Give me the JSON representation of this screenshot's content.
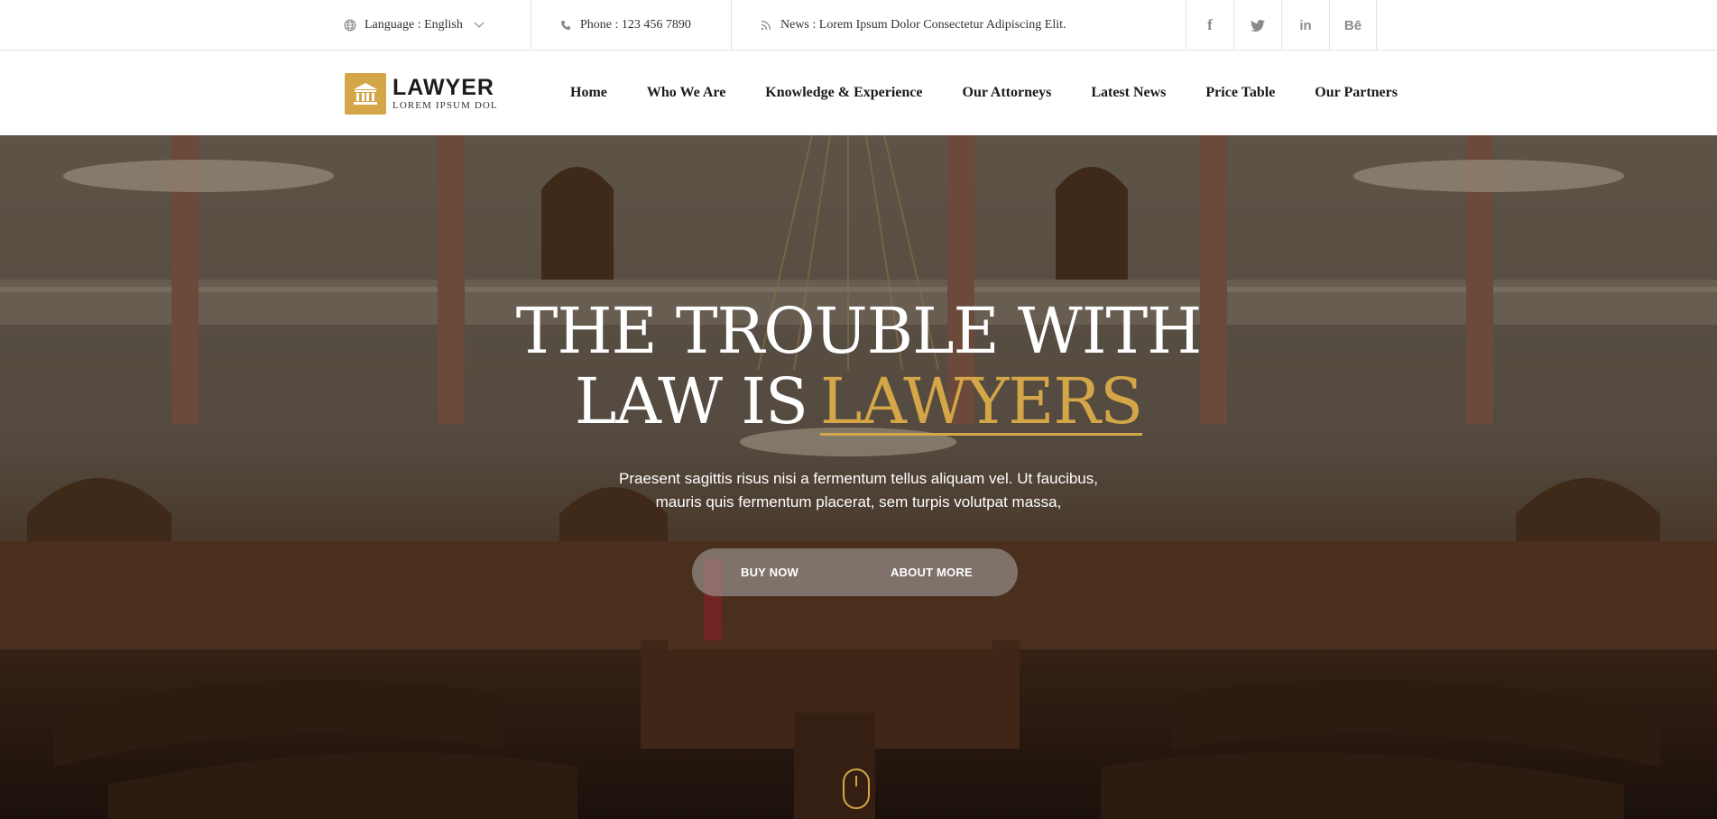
{
  "topbar": {
    "language_label": "Language : English",
    "phone_label": "Phone : 123 456 7890",
    "news_label": "News : Lorem Ipsum Dolor Consectetur Adipiscing Elit.",
    "socials": [
      "f",
      "t",
      "in",
      "Bē"
    ]
  },
  "header": {
    "logo_title": "LAWYER",
    "logo_subtitle": "LOREM IPSUM DOL",
    "nav": [
      "Home",
      "Who We Are",
      "Knowledge & Experience",
      "Our Attorneys",
      "Latest News",
      "Price Table",
      "Our Partners"
    ]
  },
  "hero": {
    "title_line1": "THE TROUBLE WITH",
    "title_line2_prefix": "LAW IS",
    "title_accent": "LAWYERS",
    "subtitle_line1": "Praesent sagittis risus nisi a fermentum tellus aliquam vel. Ut faucibus,",
    "subtitle_line2": "mauris quis fermentum placerat, sem turpis volutpat massa,",
    "buy_now": "BUY NOW",
    "about_more": "ABOUT MORE"
  },
  "colors": {
    "accent": "#d4a648",
    "text_dark": "#1a1a1a"
  }
}
